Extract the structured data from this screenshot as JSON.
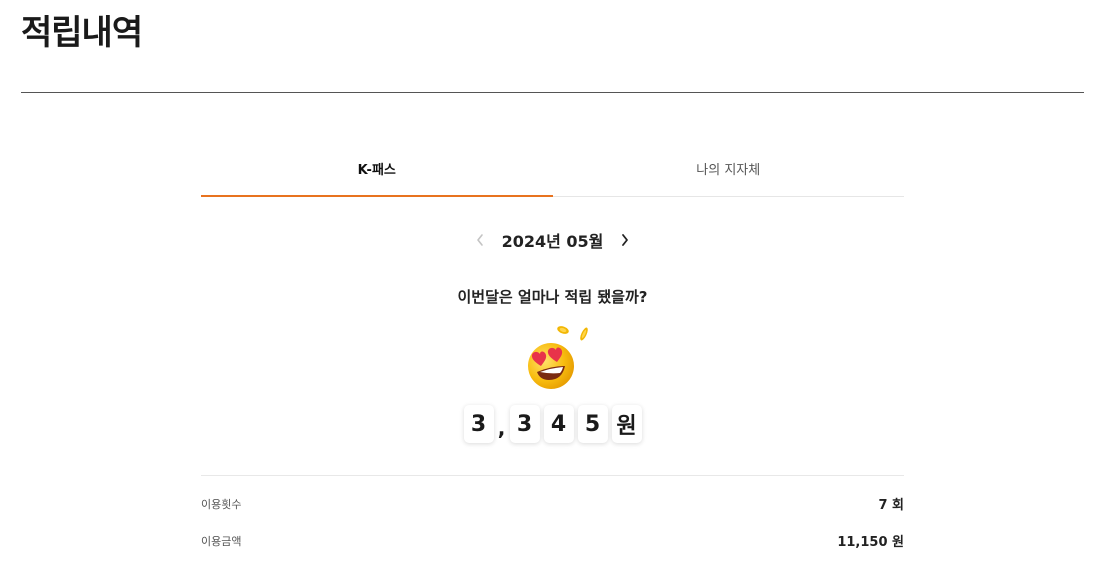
{
  "page": {
    "title": "적립내역"
  },
  "tabs": [
    {
      "label": "K-패스",
      "active": true
    },
    {
      "label": "나의 지자체",
      "active": false
    }
  ],
  "month_nav": {
    "label": "2024년 05월",
    "prev_icon": "chevron-left-icon",
    "next_icon": "chevron-right-icon"
  },
  "savings": {
    "question": "이번달은 얼마나 적립 됐을까?",
    "emoji_icon": "heart-eyes-face-with-coins-icon",
    "amount_chars": [
      "3",
      ",",
      "3",
      "4",
      "5",
      "원"
    ]
  },
  "stats": {
    "usage_count": {
      "label": "이용횟수",
      "value": "7 회"
    },
    "usage_amount": {
      "label": "이용금액",
      "value": "11,150 원"
    }
  },
  "colors": {
    "accent": "#e8731f",
    "emoji_yellow": "#f5b800",
    "heart": "#e8334a"
  }
}
